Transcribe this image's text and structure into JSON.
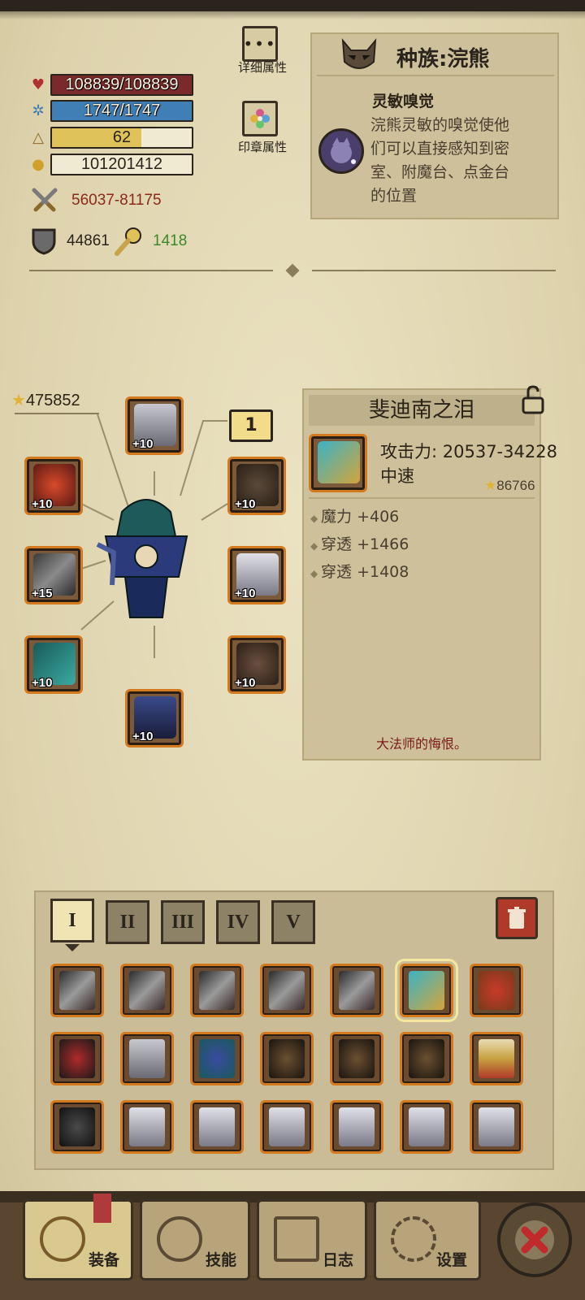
{
  "stats": {
    "hp": "108839/108839",
    "mp": "1747/1747",
    "level": "62",
    "gold": "101201412",
    "attack": "56037-81175",
    "defense": "44861",
    "luck": "1418"
  },
  "buttons": {
    "detail": "详细属性",
    "seal": "印章属性"
  },
  "race": {
    "title": "种族:浣熊",
    "trait_name": "灵敏嗅觉",
    "trait_desc_lines": [
      "浣熊灵敏的嗅觉使他",
      "们可以直接感知到密",
      "室、附魔台、点金台",
      "的位置"
    ]
  },
  "equipment": {
    "total_score": "475852",
    "page_badge": "1",
    "slots": [
      {
        "level": "+10"
      },
      {
        "level": "+10"
      },
      {
        "level": "+10"
      },
      {
        "level": "+15"
      },
      {
        "level": "+10"
      },
      {
        "level": "+10"
      },
      {
        "level": "+10"
      },
      {
        "level": "+10"
      }
    ]
  },
  "item": {
    "name": "斐迪南之泪",
    "attack": "攻击力: 20537-34228",
    "speed": "中速",
    "score": "86766",
    "affixes": [
      "魔力 +406",
      "穿透 +1466",
      "穿透 +1408"
    ],
    "flavor": "大法师的悔恨。"
  },
  "inventory": {
    "tabs": [
      "I",
      "II",
      "III",
      "IV",
      "V"
    ],
    "active_tab": 0
  },
  "nav": {
    "equip": "装备",
    "skills": "技能",
    "log": "日志",
    "settings": "设置"
  },
  "colors": {
    "hp_bar": "#7a2a2a",
    "mp_bar": "#3f7fb6",
    "xp_bar": "#e0c25a",
    "attack_text": "#8a2a1a",
    "luck_text": "#3a8a2a",
    "slot_border": "#d47a1e"
  }
}
